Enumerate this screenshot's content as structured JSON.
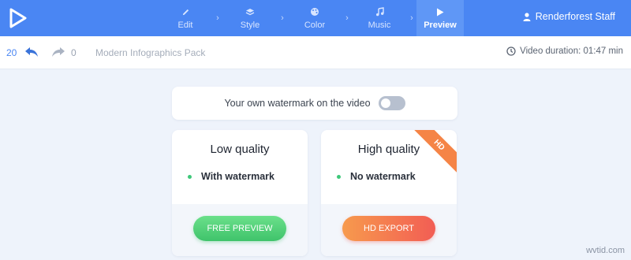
{
  "nav": {
    "steps": [
      {
        "label": "Edit",
        "icon": "pencil-icon"
      },
      {
        "label": "Style",
        "icon": "layers-icon"
      },
      {
        "label": "Color",
        "icon": "palette-icon"
      },
      {
        "label": "Music",
        "icon": "music-note-icon"
      },
      {
        "label": "Preview",
        "icon": "play-icon",
        "active": true
      }
    ],
    "user_name": "Renderforest Staff"
  },
  "subbar": {
    "undo_count": "20",
    "redo_count": "0",
    "project_title": "Modern Infographics Pack",
    "duration": "Video duration: 01:47 min"
  },
  "watermark": {
    "label": "Your own watermark on the video",
    "enabled": false
  },
  "plans": [
    {
      "title": "Low quality",
      "feature": "With watermark",
      "button": "FREE PREVIEW"
    },
    {
      "title": "High quality",
      "feature": "No watermark",
      "button": "HD EXPORT",
      "badge": "HD"
    }
  ],
  "corner_mark": "wvtid.com",
  "colors": {
    "topbar": "#4a86f3",
    "background": "#eef3fb",
    "green_button": "#3fc36b",
    "orange_button": "#f58446",
    "bullet": "#3ec87a"
  }
}
